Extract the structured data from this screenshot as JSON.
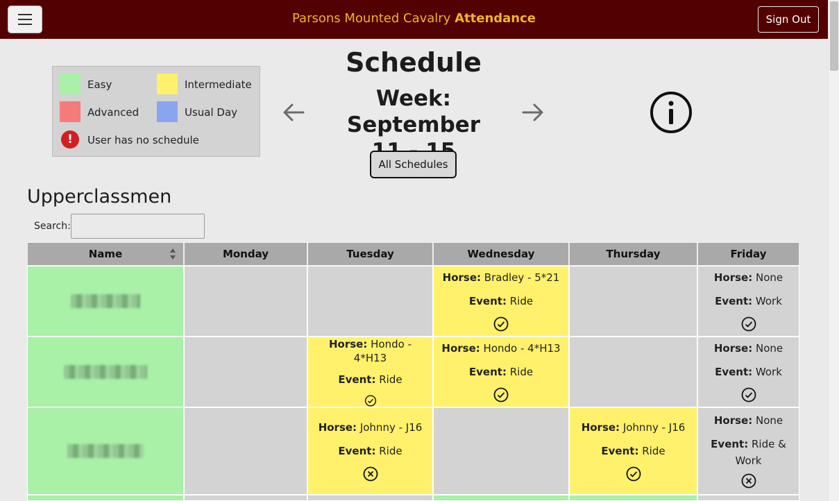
{
  "navbar": {
    "brand_prefix": "Parsons Mounted Cavalry",
    "brand_bold": "Attendance",
    "signout_label": "Sign Out",
    "menu_icon": "hamburger-menu-icon"
  },
  "legend": {
    "items": [
      {
        "label": "Easy",
        "color": "#a8f1a7"
      },
      {
        "label": "Intermediate",
        "color": "#fff16b"
      },
      {
        "label": "Advanced",
        "color": "#f67a7a"
      },
      {
        "label": "Usual Day",
        "color": "#8aa4f0"
      }
    ],
    "alert_label": "User has no schedule",
    "alert_icon": "exclamation-circle-icon"
  },
  "header": {
    "title": "Schedule",
    "week_line1": "Week: September",
    "week_line2": "11 - 15",
    "all_schedules_label": "All Schedules",
    "info_icon": "info-circle-icon"
  },
  "section": {
    "title": "Upperclassmen",
    "search_label": "Search:",
    "search_value": ""
  },
  "table": {
    "columns": [
      "Name",
      "Monday",
      "Tuesday",
      "Wednesday",
      "Thursday",
      "Friday"
    ],
    "horse_label": "Horse:",
    "event_label": "Event:",
    "rows": [
      {
        "name": "",
        "monday": null,
        "tuesday": null,
        "wednesday": {
          "horse": "Bradley - 5*21",
          "event": "Ride",
          "status": "check-circle-icon",
          "color": "#fff16b"
        },
        "thursday": null,
        "friday": {
          "horse": "None",
          "event": "Work",
          "status": "check-circle-icon",
          "color": "#d3d3d3"
        }
      },
      {
        "name": "",
        "monday": null,
        "tuesday": {
          "horse": "Hondo - 4*H13",
          "event": "Ride",
          "status": "check-circle-icon",
          "color": "#fff16b"
        },
        "wednesday": {
          "horse": "Hondo - 4*H13",
          "event": "Ride",
          "status": "check-circle-icon",
          "color": "#fff16b"
        },
        "thursday": null,
        "friday": {
          "horse": "None",
          "event": "Work",
          "status": "check-circle-icon",
          "color": "#d3d3d3"
        }
      },
      {
        "name": "",
        "monday": null,
        "tuesday": {
          "horse": "Johnny - J16",
          "event": "Ride",
          "status": "x-circle-icon",
          "color": "#fff16b"
        },
        "wednesday": null,
        "thursday": {
          "horse": "Johnny - J16",
          "event": "Ride",
          "status": "check-circle-icon",
          "color": "#fff16b"
        },
        "friday": {
          "horse": "None",
          "event": "Ride &",
          "event_cont": "Work",
          "status": "x-circle-icon",
          "color": "#d3d3d3"
        }
      }
    ]
  }
}
